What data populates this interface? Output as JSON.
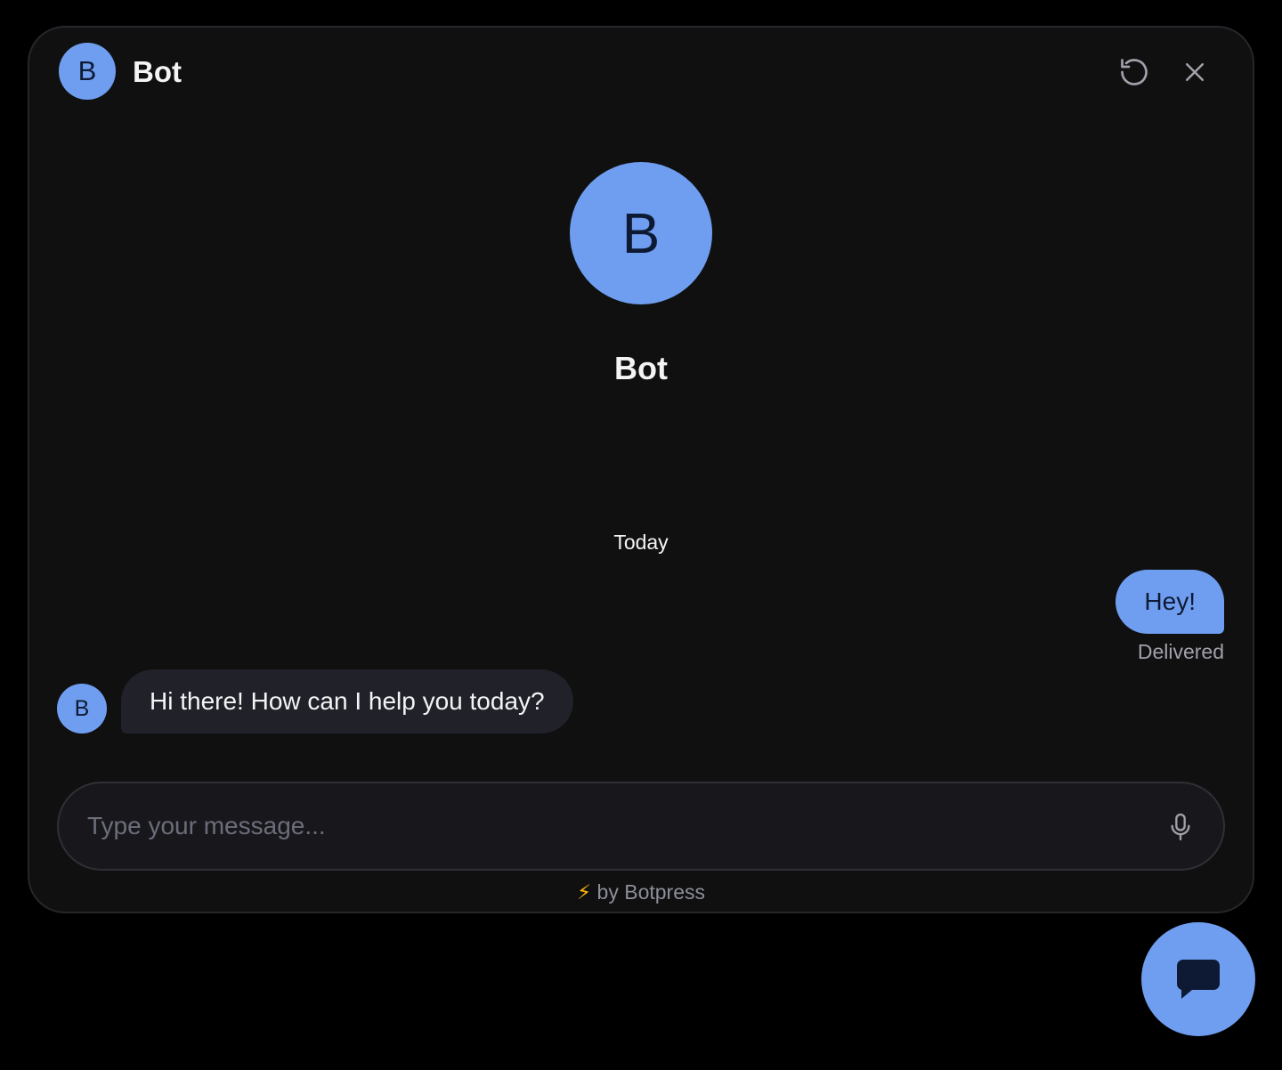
{
  "header": {
    "avatar_initial": "B",
    "title": "Bot",
    "refresh_icon": "refresh-icon",
    "close_icon": "close-icon"
  },
  "hero": {
    "avatar_initial": "B",
    "name": "Bot"
  },
  "conversation": {
    "date_divider": "Today",
    "messages": [
      {
        "sender": "user",
        "text": "Hey!",
        "status": "Delivered"
      },
      {
        "sender": "bot",
        "avatar_initial": "B",
        "text": "Hi there! How can I help you today?"
      }
    ]
  },
  "composer": {
    "placeholder": "Type your message...",
    "mic_icon": "microphone-icon"
  },
  "footer": {
    "bolt": "⚡",
    "text": "by Botpress"
  },
  "fab": {
    "icon": "chat-bubble-icon"
  },
  "colors": {
    "accent": "#6f9ef0",
    "panel_bg": "#101011",
    "bot_bubble_bg": "#202129",
    "page_bg": "#000000"
  }
}
